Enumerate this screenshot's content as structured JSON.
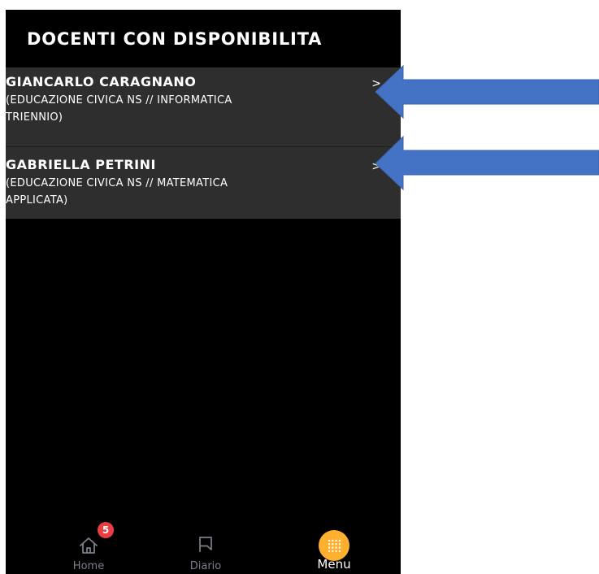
{
  "header": {
    "title": "DOCENTI CON DISPONIBILITA"
  },
  "teachers": [
    {
      "name": "GIANCARLO CARAGNANO",
      "subjects_line1": "(EDUCAZIONE CIVICA NS // INFORMATICA",
      "subjects_line2": "TRIENNIO)",
      "chevron": ">"
    },
    {
      "name": "GABRIELLA PETRINI",
      "subjects_line1": "(EDUCAZIONE CIVICA NS // MATEMATICA",
      "subjects_line2": "APPLICATA)",
      "chevron": ">"
    }
  ],
  "bottom_nav": {
    "items": [
      {
        "label": "Home",
        "icon": "home-icon",
        "badge": "5",
        "active": false
      },
      {
        "label": "Diario",
        "icon": "bookmark-icon",
        "active": false
      },
      {
        "label": "Menu",
        "icon": "dots-grid-icon",
        "active": true
      }
    ]
  },
  "colors": {
    "background": "#000000",
    "row": "#2e2e2e",
    "accent": "#ffb02e",
    "badge": "#ea3d44",
    "arrow": "#4472c4",
    "inactive_nav": "#7b7f8c"
  }
}
